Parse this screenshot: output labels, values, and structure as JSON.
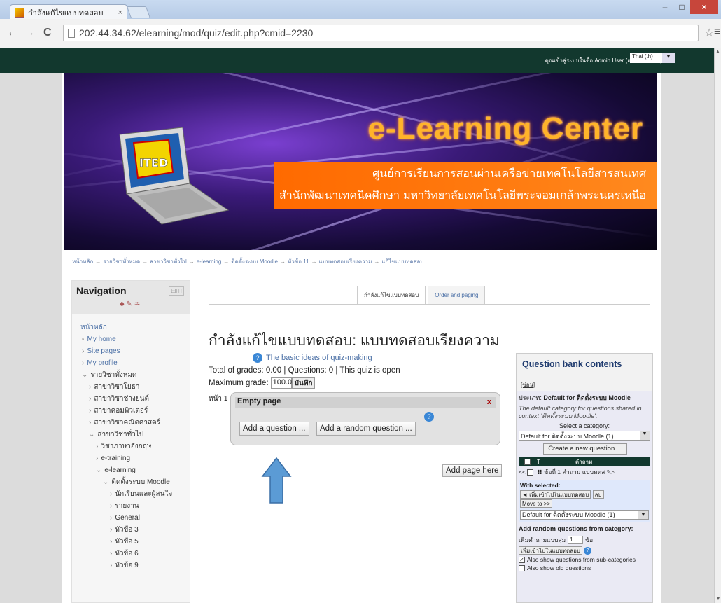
{
  "browser": {
    "tab_title": "กำลังแก้ไขแบบทดสอบ",
    "tab_close": "×",
    "url": "202.44.34.62/elearning/mod/quiz/edit.php?cmid=2230",
    "back": "←",
    "forward": "→",
    "reload": "C",
    "star": "☆",
    "menu": "≡",
    "minimize": "–",
    "maximize": "□",
    "close": "×"
  },
  "topbar": {
    "login_text": "คุณเข้าสู่ระบบในชื่อ Admin User (ออกจากระบบ)",
    "language": "Thai (th)",
    "language_arrow": "▼"
  },
  "banner": {
    "title": "e-Learning Center",
    "line1": "ศูนย์การเรียนการสอนผ่านเครือข่ายเทคโนโลยีสารสนเทศ",
    "line2": "สำนักพัฒนาเทคนิคศึกษา มหาวิทยาลัยเทคโนโลยีพระจอมเกล้าพระนครเหนือ",
    "logo_text": "ITED"
  },
  "breadcrumb": {
    "items": [
      "หน้าหลัก",
      "รายวิชาทั้งหมด",
      "สาขาวิชาทั่วไป",
      "e-learning",
      "ติดตั้งระบบ Moodle",
      "หัวข้อ 11",
      "แบบทดสอบเรียงความ",
      "แก้ไขแบบทดสอบ"
    ],
    "separator": "→"
  },
  "navigation": {
    "title": "Navigation",
    "controls": "⊟◫",
    "icons": "♣ ✎ ♒",
    "items": [
      {
        "label": "หน้าหลัก",
        "indent": 0,
        "prefix": ""
      },
      {
        "label": "My home",
        "indent": 0,
        "prefix": "▫"
      },
      {
        "label": "Site pages",
        "indent": 0,
        "prefix": "›"
      },
      {
        "label": "My profile",
        "indent": 0,
        "prefix": "›"
      },
      {
        "label": "รายวิชาทั้งหมด",
        "indent": 0,
        "prefix": "⌄"
      },
      {
        "label": "สาขาวิชาโยธา",
        "indent": 1,
        "prefix": "›"
      },
      {
        "label": "สาขาวิชาช่างยนต์",
        "indent": 1,
        "prefix": "›"
      },
      {
        "label": "สาขาคอมพิวเตอร์",
        "indent": 1,
        "prefix": "›"
      },
      {
        "label": "สาขาวิชาคณิตศาสตร์",
        "indent": 1,
        "prefix": "›"
      },
      {
        "label": "สาขาวิชาทั่วไป",
        "indent": 1,
        "prefix": "⌄"
      },
      {
        "label": "วิชาภาษาอังกฤษ",
        "indent": 2,
        "prefix": "›"
      },
      {
        "label": "e-training",
        "indent": 2,
        "prefix": "›"
      },
      {
        "label": "e-learning",
        "indent": 2,
        "prefix": "⌄"
      },
      {
        "label": "ติดตั้งระบบ Moodle",
        "indent": 3,
        "prefix": "⌄"
      },
      {
        "label": "นักเรียนและผู้สนใจ",
        "indent": 4,
        "prefix": "›"
      },
      {
        "label": "รายงาน",
        "indent": 4,
        "prefix": "›"
      },
      {
        "label": "General",
        "indent": 4,
        "prefix": "›"
      },
      {
        "label": "หัวข้อ 3",
        "indent": 4,
        "prefix": "›"
      },
      {
        "label": "หัวข้อ 5",
        "indent": 4,
        "prefix": "›"
      },
      {
        "label": "หัวข้อ 6",
        "indent": 4,
        "prefix": "›"
      },
      {
        "label": "หัวข้อ 9",
        "indent": 4,
        "prefix": "›"
      }
    ]
  },
  "tabs": {
    "edit": "กำลังแก้ไขแบบทดสอบ",
    "order": "Order and paging"
  },
  "main": {
    "heading": "กำลังแก้ไขแบบทดสอบ: แบบทดสอบเรียงความ",
    "help_glyph": "?",
    "ideas_link": "The basic ideas of quiz-making",
    "totals": "Total of grades: 0.00 | Questions: 0 | This quiz is open",
    "max_grade_label": "Maximum grade:",
    "max_grade_value": "100.0",
    "save": "บันทึก",
    "page_label": "หน้า 1",
    "empty_page": "Empty page",
    "panel_close": "x",
    "add_question": "Add a question ...",
    "add_random": "Add a random question ...",
    "add_page": "Add page here"
  },
  "qbank": {
    "title": "Question bank contents",
    "hide": "[ซ่อน]",
    "category_label": "ประเภท:",
    "category_name": "Default for ติดตั้งระบบ Moodle",
    "category_desc": "The default category for questions shared in context 'ติดตั้งระบบ Moodle'.",
    "select_label": "Select a category:",
    "select_value": "Default for ติดตั้งระบบ Moodle (1)",
    "create_btn": "Create a new question ...",
    "col_t": "T",
    "col_question": "คำถาม",
    "nav_prev": "<<",
    "question_row": "ข้อที่ 1 คำถาม แบบทดส",
    "with_selected": "With selected:",
    "add_to_quiz": "◄ เพิ่มเข้าไปในแบบทดสอบ",
    "delete": "ลบ",
    "move_to": "Move to >>",
    "move_value": "Default for ติดตั้งระบบ Moodle (1)",
    "add_random_title": "Add random questions from category:",
    "add_count_label": "เพิ่มคำถามแบบสุ่ม",
    "add_count_value": "1",
    "add_count_unit": "ข้อ",
    "add_random_btn": "เพิ่มเข้าไปในแบบทดสอบ",
    "check_mark": "✓",
    "show_sub": "Also show questions from sub-categories",
    "show_old": "Also show old questions"
  }
}
